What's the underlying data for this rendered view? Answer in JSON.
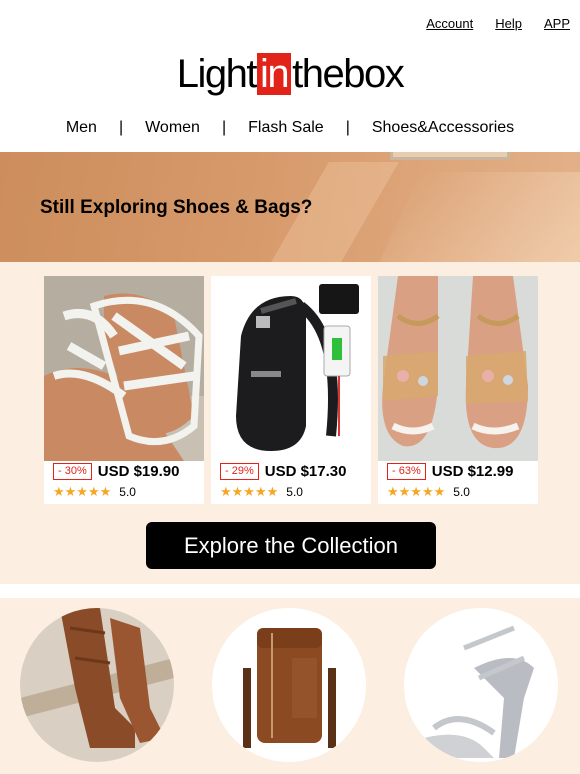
{
  "header": {
    "links": [
      "Account",
      "Help",
      "APP"
    ],
    "logo": {
      "part1": "Light",
      "part2": "in",
      "part3": "thebox"
    }
  },
  "nav": {
    "items": [
      "Men",
      "Women",
      "Flash Sale",
      "Shoes&Accessories"
    ],
    "separator": "|"
  },
  "banner": {
    "title": "Still Exploring Shoes & Bags?"
  },
  "products": [
    {
      "discount": "- 30%",
      "price": "USD $19.90",
      "stars": "★★★★★",
      "rating": "5.0"
    },
    {
      "discount": "- 29%",
      "price": "USD $17.30",
      "stars": "★★★★★",
      "rating": "5.0"
    },
    {
      "discount": "- 63%",
      "price": "USD $12.99",
      "stars": "★★★★★",
      "rating": "5.0"
    }
  ],
  "cta": {
    "label": "Explore the Collection"
  },
  "colors": {
    "brand_red": "#e2231a",
    "section_bg": "#fdeee2",
    "star": "#f5a623"
  }
}
